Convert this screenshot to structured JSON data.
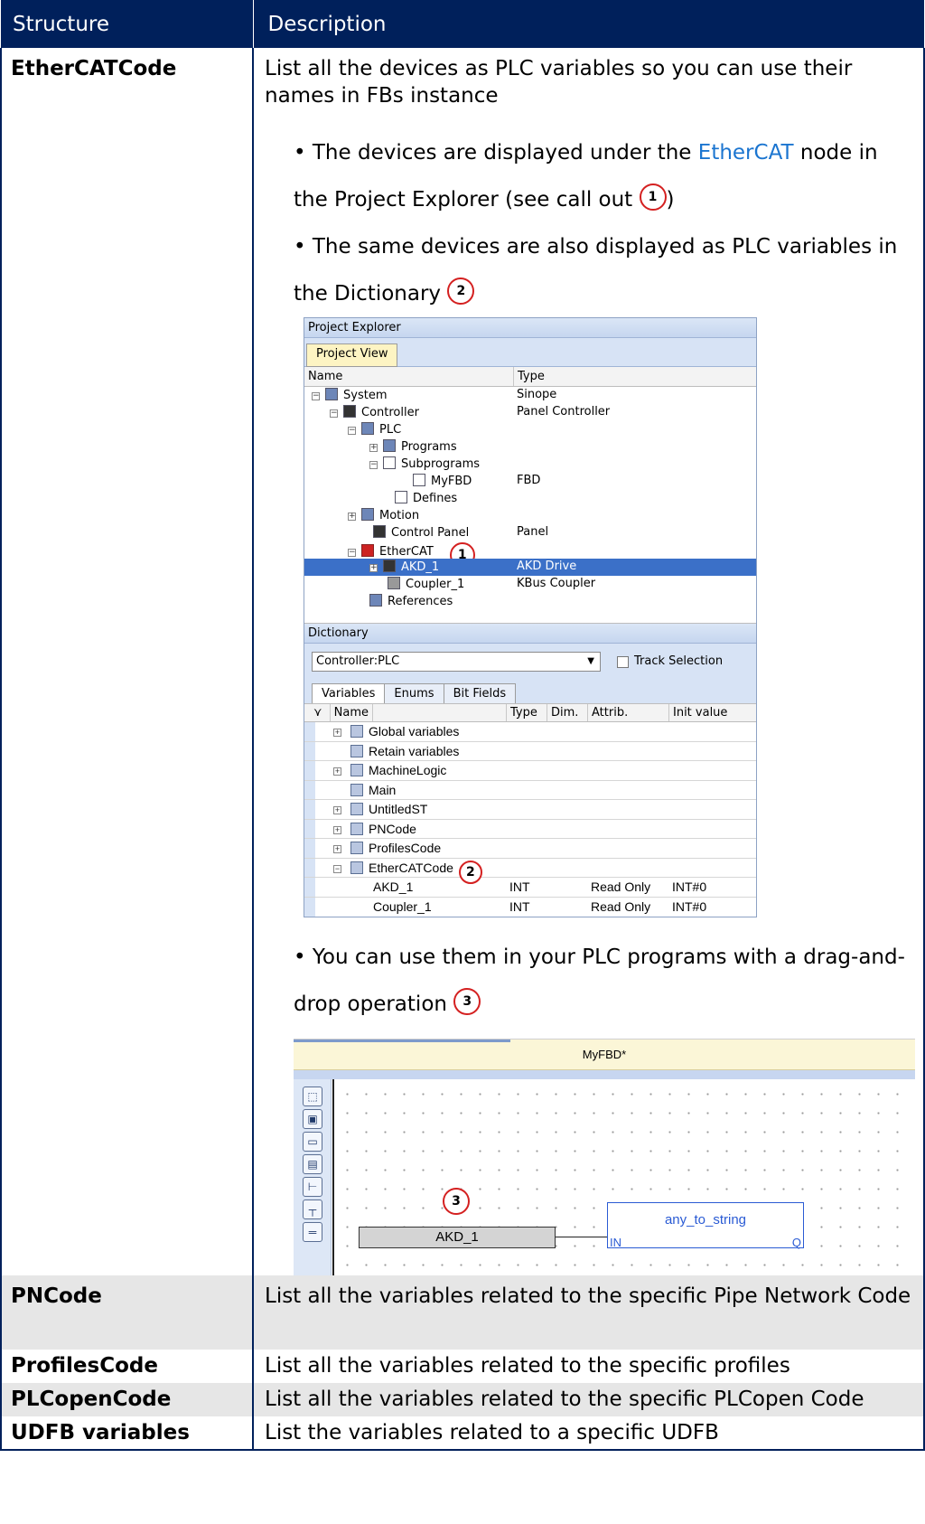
{
  "table": {
    "header": {
      "structure": "Structure",
      "description": "Description"
    },
    "ethercat": {
      "name": "EtherCATCode",
      "description": "List all the devices as PLC variables so you can use their names in FBs instance",
      "bullet1_pre": "• The devices are displayed under the ",
      "bullet1_link": "EtherCAT",
      "bullet1_post": " node in the Project Explorer (see call out ",
      "bullet1_end": ")",
      "bullet2": "• The same devices are also displayed as PLC variables in the Dictionary ",
      "bullet3": "• You can use them in your PLC programs with a drag-and-drop operation "
    },
    "rows": [
      {
        "name": "PNCode",
        "description": "List all the variables related to the specific Pipe Network Code"
      },
      {
        "name": "ProfilesCode",
        "description": "List all the variables related to the specific profiles"
      },
      {
        "name": "PLCopenCode",
        "description": "List all the variables related to the specific PLCopen Code"
      },
      {
        "name": "UDFB variables",
        "description": "List the variables related to a specific UDFB"
      }
    ]
  },
  "callouts": {
    "one": "1",
    "two": "2",
    "three": "3"
  },
  "project_explorer": {
    "title": "Project Explorer",
    "tab": "Project View",
    "col_name": "Name",
    "col_type": "Type",
    "tree": [
      {
        "name": "System",
        "type": "Sinope"
      },
      {
        "name": "Controller",
        "type": "Panel Controller"
      },
      {
        "name": "PLC",
        "type": ""
      },
      {
        "name": "Programs",
        "type": ""
      },
      {
        "name": "Subprograms",
        "type": ""
      },
      {
        "name": "MyFBD",
        "type": "FBD"
      },
      {
        "name": "Defines",
        "type": ""
      },
      {
        "name": "Motion",
        "type": ""
      },
      {
        "name": "Control Panel",
        "type": "Panel"
      },
      {
        "name": "EtherCAT",
        "type": ""
      },
      {
        "name": "AKD_1",
        "type": "AKD Drive"
      },
      {
        "name": "Coupler_1",
        "type": "KBus Coupler"
      },
      {
        "name": "References",
        "type": ""
      }
    ]
  },
  "dictionary": {
    "title": "Dictionary",
    "dropdown": "Controller:PLC",
    "track_selection": "Track Selection",
    "tabs": [
      "Variables",
      "Enums",
      "Bit Fields"
    ],
    "headers": [
      "Name",
      "Type",
      "Dim.",
      "Attrib.",
      "Init value"
    ],
    "groups": [
      "Global variables",
      "Retain variables",
      "MachineLogic",
      "Main",
      "UntitledST",
      "PNCode",
      "ProfilesCode",
      "EtherCATCode"
    ],
    "vars": [
      {
        "name": "AKD_1",
        "type": "INT",
        "attrib": "Read Only",
        "init": "INT#0"
      },
      {
        "name": "Coupler_1",
        "type": "INT",
        "attrib": "Read Only",
        "init": "INT#0"
      }
    ]
  },
  "fbd": {
    "tab_title": "MyFBD*",
    "variable": "AKD_1",
    "block_name": "any_to_string",
    "input": "IN",
    "output": "Q"
  },
  "colors": {
    "header_bg": "#00205b",
    "link": "#1b75d0",
    "stripe": "#e6e6e6",
    "callout": "#d42020",
    "selection": "#3b70c8"
  }
}
